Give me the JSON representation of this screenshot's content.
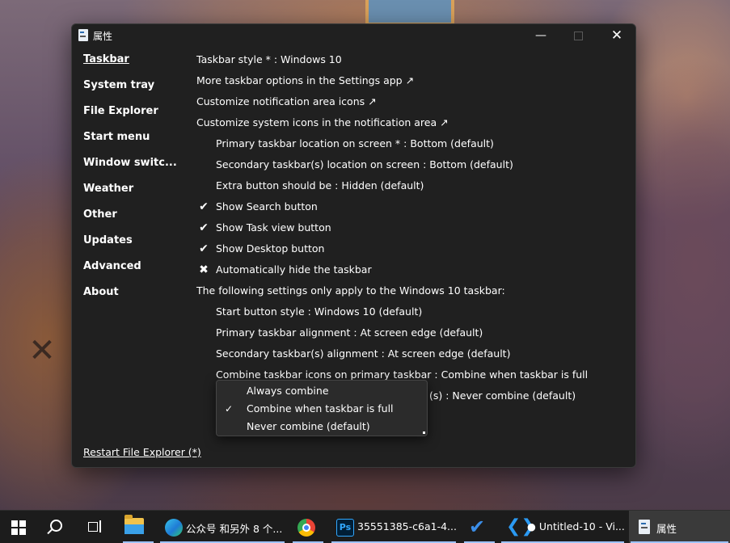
{
  "window": {
    "title": "属性",
    "minimize_glyph": "—",
    "close_glyph": "✕"
  },
  "sidebar": {
    "items": [
      {
        "label": "Taskbar",
        "active": true
      },
      {
        "label": "System tray"
      },
      {
        "label": "File Explorer"
      },
      {
        "label": "Start menu"
      },
      {
        "label": "Window switc..."
      },
      {
        "label": "Weather"
      },
      {
        "label": "Other"
      },
      {
        "label": "Updates"
      },
      {
        "label": "Advanced"
      },
      {
        "label": "About"
      }
    ],
    "restart_link": "Restart File Explorer (*)"
  },
  "settings": {
    "taskbar_style": "Taskbar style * : Windows 10",
    "more_options": "More taskbar options in the Settings app ↗",
    "notification_icons": "Customize notification area icons ↗",
    "system_icons": "Customize system icons in the notification area ↗",
    "primary_location": "Primary taskbar location on screen * : Bottom (default)",
    "secondary_location": "Secondary taskbar(s) location on screen : Bottom (default)",
    "extra_button": "Extra button should be : Hidden (default)",
    "show_search": {
      "mark": "✔",
      "label": "Show Search button"
    },
    "show_taskview": {
      "mark": "✔",
      "label": "Show Task view button"
    },
    "show_desktop": {
      "mark": "✔",
      "label": "Show Desktop button"
    },
    "auto_hide": {
      "mark": "✖",
      "label": "Automatically hide the taskbar"
    },
    "win10_note": "The following settings only apply to the Windows 10 taskbar:",
    "start_button_style": "Start button style : Windows 10 (default)",
    "primary_alignment": "Primary taskbar alignment : At screen edge (default)",
    "secondary_alignment": "Secondary taskbar(s) alignment : At screen edge (default)",
    "combine_primary": "Combine taskbar icons on primary taskbar : Combine when taskbar is full",
    "combine_secondary_tail": "(s) : Never combine (default)"
  },
  "dropdown": {
    "check_glyph": "✓",
    "options": [
      {
        "label": "Always combine",
        "selected": false
      },
      {
        "label": "Combine when taskbar is full",
        "selected": true
      },
      {
        "label": "Never combine (default)",
        "selected": false
      }
    ]
  },
  "taskbar": {
    "edge_label": "公众号 和另外 8 个...",
    "ps_icon_text": "Ps",
    "ps_label": "35551385-c6a1-4...",
    "vscode_label": "● Untitled-10 - Vi...",
    "settings_label": "属性"
  },
  "colors": {
    "window_bg": "#202020",
    "taskbar_bg": "#1c1c1c",
    "accent": "#9ec3ff"
  }
}
